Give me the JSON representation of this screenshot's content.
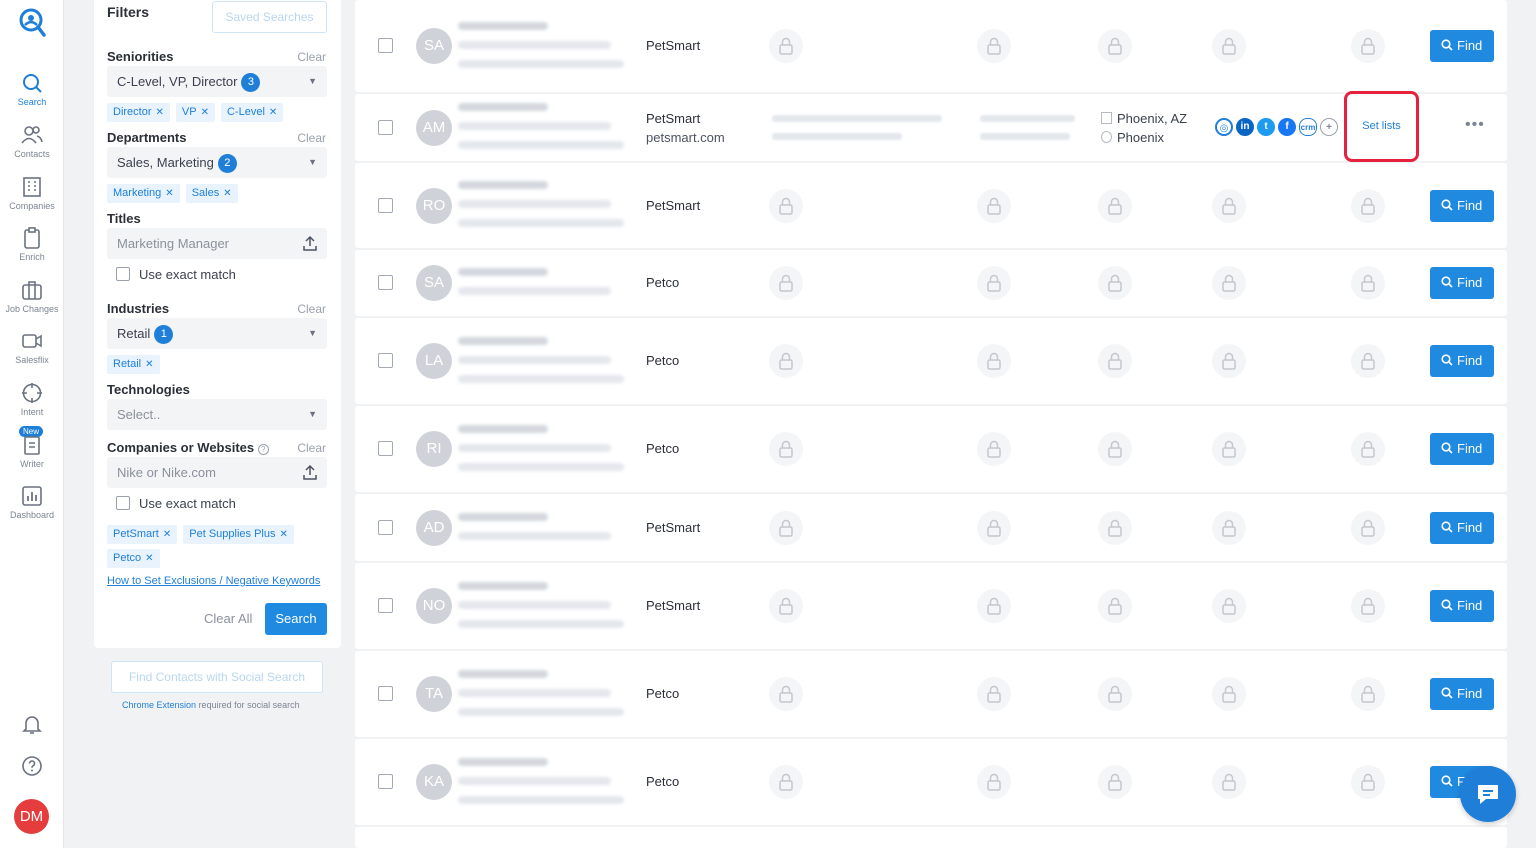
{
  "nav": {
    "items": [
      {
        "label": "Search",
        "icon": "search-icon"
      },
      {
        "label": "Contacts",
        "icon": "contacts-icon"
      },
      {
        "label": "Companies",
        "icon": "building-icon"
      },
      {
        "label": "Enrich",
        "icon": "clipboard-icon"
      },
      {
        "label": "Job Changes",
        "icon": "briefcase-icon"
      },
      {
        "label": "Salesflix",
        "icon": "video-icon"
      },
      {
        "label": "Intent",
        "icon": "target-icon"
      },
      {
        "label": "Writer",
        "icon": "document-icon"
      },
      {
        "label": "Dashboard",
        "icon": "chart-icon"
      }
    ],
    "new_badge": "New",
    "avatar": "DM",
    "accent": "#1f7fd8"
  },
  "filters": {
    "title": "Filters",
    "saved_searches": "Saved Searches",
    "clear": "Clear",
    "seniorities": {
      "label": "Seniorities",
      "value": "C-Level, VP, Director",
      "count": "3",
      "chips": [
        "Director",
        "VP",
        "C-Level"
      ]
    },
    "departments": {
      "label": "Departments",
      "value": "Sales, Marketing",
      "count": "2",
      "chips": [
        "Marketing",
        "Sales"
      ]
    },
    "titles": {
      "label": "Titles",
      "placeholder": "Marketing Manager",
      "exact": "Use exact match"
    },
    "industries": {
      "label": "Industries",
      "value": "Retail",
      "count": "1",
      "chips": [
        "Retail"
      ]
    },
    "technologies": {
      "label": "Technologies",
      "placeholder": "Select.."
    },
    "companies": {
      "label": "Companies or Websites",
      "placeholder": "Nike or Nike.com",
      "exact": "Use exact match",
      "chips": [
        "PetSmart",
        "Pet Supplies Plus",
        "Petco"
      ]
    },
    "help_link": "How to Set Exclusions / Negative Keywords",
    "clear_all": "Clear All",
    "search": "Search"
  },
  "social": {
    "button": "Find Contacts with Social Search",
    "note_link": "Chrome Extension",
    "note_rest": "required for social search"
  },
  "results": {
    "find_label": "Find",
    "rows": [
      {
        "initials": "SA",
        "company": "PetSmart"
      },
      {
        "initials": "AM",
        "company": "PetSmart",
        "domain": "petsmart.com",
        "location_1": "Phoenix, AZ",
        "location_2": "Phoenix",
        "set_lists": "Set lists"
      },
      {
        "initials": "RO",
        "company": "PetSmart"
      },
      {
        "initials": "SA",
        "company": "Petco"
      },
      {
        "initials": "LA",
        "company": "Petco"
      },
      {
        "initials": "RI",
        "company": "Petco"
      },
      {
        "initials": "AD",
        "company": "PetSmart"
      },
      {
        "initials": "NO",
        "company": "PetSmart"
      },
      {
        "initials": "TA",
        "company": "Petco"
      },
      {
        "initials": "KA",
        "company": "Petco"
      }
    ]
  }
}
